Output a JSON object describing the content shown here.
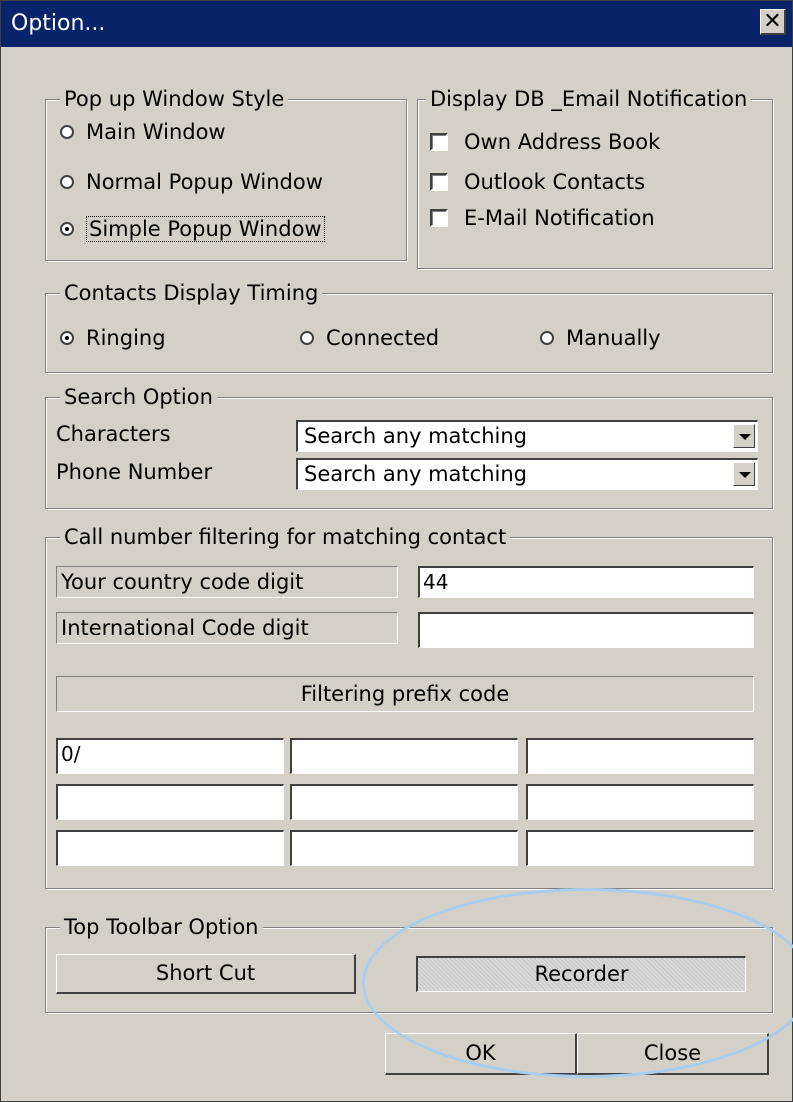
{
  "window": {
    "title": "Option...",
    "close_glyph": "✕"
  },
  "popup_style": {
    "legend": "Pop up Window Style",
    "options": [
      "Main Window",
      "Normal Popup Window",
      "Simple Popup Window"
    ],
    "selected": "Simple Popup Window"
  },
  "display_db": {
    "legend": "Display DB _Email Notification",
    "items": [
      "Own Address Book",
      "Outlook Contacts",
      "E-Mail Notification"
    ]
  },
  "timing": {
    "legend": "Contacts Display Timing",
    "options": [
      "Ringing",
      "Connected",
      "Manually"
    ],
    "selected": "Ringing"
  },
  "search": {
    "legend": "Search Option",
    "characters_label": "Characters",
    "characters_value": "Search any matching",
    "phone_label": "Phone Number",
    "phone_value": "Search any matching"
  },
  "filtering": {
    "legend": "Call number filtering for matching contact",
    "country_label": "Your country code digit",
    "country_value": "44",
    "international_label": "International Code digit",
    "international_value": "",
    "prefix_header": "Filtering prefix code",
    "prefix_codes": [
      "0/",
      "",
      "",
      "",
      "",
      "",
      "",
      "",
      ""
    ]
  },
  "toolbar": {
    "legend": "Top Toolbar Option",
    "shortcut_label": "Short Cut",
    "recorder_label": "Recorder"
  },
  "footer": {
    "ok_label": "OK",
    "close_label": "Close"
  },
  "colors": {
    "face": "#d4d0c8",
    "titlebar": "#0a246a",
    "ring": "#a9cdef"
  }
}
